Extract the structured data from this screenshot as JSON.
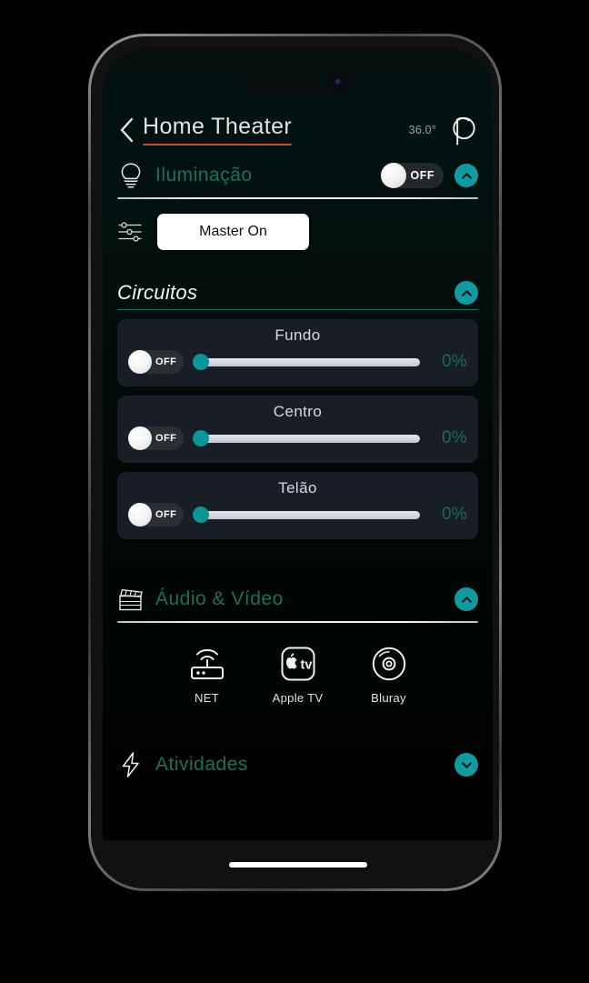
{
  "header": {
    "back_icon": "chevron-left-icon",
    "title": "Home Theater",
    "temperature": "36.0°",
    "profile_icon": "profile-logo-icon"
  },
  "lighting": {
    "icon": "lightbulb-icon",
    "title": "Iluminação",
    "toggle_label": "OFF",
    "collapse_icon": "chevron-up-icon",
    "master": {
      "icon": "sliders-icon",
      "label": "Master On"
    }
  },
  "circuits": {
    "title": "Circuitos",
    "collapse_icon": "chevron-up-icon",
    "items": [
      {
        "name": "Fundo",
        "toggle_label": "OFF",
        "percent": "0%",
        "value": 0
      },
      {
        "name": "Centro",
        "toggle_label": "OFF",
        "percent": "0%",
        "value": 0
      },
      {
        "name": "Telão",
        "toggle_label": "OFF",
        "percent": "0%",
        "value": 0
      }
    ]
  },
  "av": {
    "icon": "clapperboard-icon",
    "title": "Áudio & Vídeo",
    "collapse_icon": "chevron-up-icon",
    "devices": [
      {
        "label": "NET",
        "icon": "router-wifi-icon"
      },
      {
        "label": "Apple TV",
        "icon": "apple-tv-icon"
      },
      {
        "label": "Bluray",
        "icon": "disc-icon"
      }
    ]
  },
  "activities": {
    "icon": "lightning-bolt-icon",
    "title": "Atividades",
    "expand_icon": "chevron-down-icon"
  },
  "colors": {
    "accent_teal": "#119a9f",
    "section_green": "#1f6f5c",
    "title_underline": "#c2512f",
    "slider_thumb": "#0d9499",
    "card_bg": "#191d26"
  }
}
